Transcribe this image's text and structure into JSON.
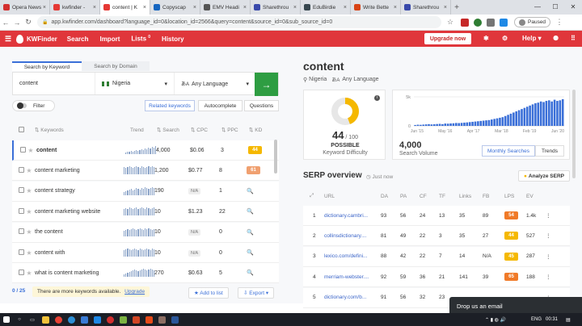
{
  "browser": {
    "tabs": [
      {
        "label": "Opera News",
        "color": "#d32f2f",
        "active": false
      },
      {
        "label": "kwfinder -",
        "color": "#e53935",
        "active": false
      },
      {
        "label": "content | K",
        "color": "#e53935",
        "active": true
      },
      {
        "label": "Copyscap",
        "color": "#1565c0",
        "active": false
      },
      {
        "label": "EMV Headi",
        "color": "#555555",
        "active": false
      },
      {
        "label": "Sharethrou",
        "color": "#3949ab",
        "active": false
      },
      {
        "label": "EduBirdie",
        "color": "#37474f",
        "active": false
      },
      {
        "label": "Write Bette",
        "color": "#d84315",
        "active": false
      },
      {
        "label": "Sharethrou",
        "color": "#3949ab",
        "active": false
      }
    ],
    "new_tab": "+",
    "url": "app.kwfinder.com/dashboard?language_id=0&location_id=2566&query=content&source_id=0&sub_source_id=0",
    "profile_label": "Paused"
  },
  "app": {
    "brand": "KWFinder",
    "nav": {
      "search": "Search",
      "import": "Import",
      "lists": "Lists",
      "lists_count": "0",
      "history": "History"
    },
    "upgrade_label": "Upgrade now",
    "help_label": "Help"
  },
  "search": {
    "tab_keyword": "Search by Keyword",
    "tab_domain": "Search by Domain",
    "query": "content",
    "location": "Nigeria",
    "language": "Any Language",
    "go": "→"
  },
  "filters": {
    "filter_label": "Filter",
    "tab_related": "Related keywords",
    "tab_autocomplete": "Autocomplete",
    "tab_questions": "Questions"
  },
  "table": {
    "headers": {
      "keywords": "Keywords",
      "trend": "Trend",
      "search": "Search",
      "cpc": "CPC",
      "ppc": "PPC",
      "kd": "KD"
    },
    "rows": [
      {
        "keyword": "content",
        "search": "4,000",
        "cpc": "$0.06",
        "ppc": "3",
        "kd": "44",
        "kd_color": "#f5b800",
        "trend": [
          2,
          3,
          3,
          4,
          3,
          4,
          5,
          4,
          5,
          6,
          5,
          7,
          6,
          8,
          7,
          9,
          8,
          10
        ]
      },
      {
        "keyword": "content marketing",
        "search": "1,200",
        "cpc": "$0.77",
        "ppc": "8",
        "kd": "61",
        "kd_color": "#f0a070",
        "trend": [
          9,
          8,
          9,
          10,
          9,
          8,
          9,
          10,
          9,
          8,
          10,
          9,
          8,
          9,
          10,
          9,
          10,
          9
        ]
      },
      {
        "keyword": "content strategy",
        "search": "190",
        "cpc": "N/A",
        "ppc": "1",
        "kd": "🔍",
        "kd_color": "",
        "trend": [
          4,
          5,
          6,
          7,
          8,
          6,
          7,
          9,
          8,
          7,
          9,
          8,
          10,
          9,
          8,
          9,
          10,
          9
        ]
      },
      {
        "keyword": "content marketing website",
        "search": "10",
        "cpc": "$1.23",
        "ppc": "22",
        "kd": "🔍",
        "kd_color": "",
        "trend": [
          8,
          9,
          8,
          10,
          9,
          8,
          9,
          10,
          8,
          9,
          10,
          9,
          8,
          10,
          9,
          8,
          9,
          10
        ]
      },
      {
        "keyword": "the content",
        "search": "10",
        "cpc": "N/A",
        "ppc": "0",
        "kd": "🔍",
        "kd_color": "",
        "trend": [
          7,
          8,
          9,
          8,
          9,
          10,
          9,
          8,
          9,
          10,
          9,
          8,
          10,
          9,
          10,
          9,
          8,
          9
        ]
      },
      {
        "keyword": "content with",
        "search": "10",
        "cpc": "N/A",
        "ppc": "0",
        "kd": "🔍",
        "kd_color": "",
        "trend": [
          8,
          9,
          10,
          9,
          8,
          9,
          10,
          9,
          8,
          10,
          9,
          8,
          9,
          10,
          9,
          8,
          10,
          9
        ]
      },
      {
        "keyword": "what is content marketing",
        "search": "270",
        "cpc": "$0.63",
        "ppc": "5",
        "kd": "🔍",
        "kd_color": "",
        "trend": [
          3,
          4,
          5,
          6,
          7,
          8,
          9,
          8,
          7,
          8,
          9,
          10,
          9,
          8,
          9,
          10,
          9,
          8
        ]
      }
    ],
    "count_selected": "0 / 25",
    "more_notice": "There are more keywords available.",
    "upgrade_link": "Upgrade",
    "add_to_list": "Add to list",
    "export": "Export"
  },
  "detail": {
    "keyword": "content",
    "location": "Nigeria",
    "language": "Any Language",
    "kd_value": "44",
    "kd_max": "/ 100",
    "kd_label": "POSSIBLE",
    "kd_caption": "Keyword Difficulty",
    "kd_fraction": 0.44,
    "volume": "4,000",
    "volume_caption": "Search Volume",
    "btn_monthly": "Monthly Searches",
    "btn_trends": "Trends"
  },
  "chart_data": {
    "type": "bar",
    "title": "",
    "y_ticks": [
      "5k",
      "0"
    ],
    "x_ticks": [
      "Jun '15",
      "May '16",
      "Apr '17",
      "Mar '18",
      "Feb '19",
      "Jun '20"
    ],
    "ylim": [
      0,
      5000
    ],
    "values": [
      150,
      200,
      180,
      220,
      260,
      300,
      250,
      280,
      320,
      350,
      300,
      400,
      380,
      420,
      450,
      500,
      480,
      520,
      560,
      600,
      650,
      700,
      750,
      800,
      850,
      900,
      950,
      1000,
      1100,
      1200,
      1300,
      1400,
      1500,
      1700,
      1900,
      2100,
      2300,
      2500,
      2700,
      2900,
      3100,
      3300,
      3500,
      3700,
      3900,
      4000,
      4200,
      4100,
      4300,
      4400,
      4200,
      4500,
      4300,
      4400,
      4600
    ]
  },
  "serp": {
    "title": "SERP overview",
    "timestamp": "Just now",
    "analyze_label": "Analyze SERP",
    "headers": {
      "url": "URL",
      "da": "DA",
      "pa": "PA",
      "cf": "CF",
      "tf": "TF",
      "links": "Links",
      "fb": "FB",
      "lps": "LPS",
      "ev": "EV"
    },
    "rows": [
      {
        "n": "1",
        "url": "dictionary.cambri...",
        "da": "93",
        "pa": "56",
        "cf": "24",
        "tf": "13",
        "links": "35",
        "fb": "89",
        "lps": "54",
        "lps_color": "#f07a28",
        "ev": "1.4k"
      },
      {
        "n": "2",
        "url": "collinsdictionary....",
        "da": "81",
        "pa": "49",
        "cf": "22",
        "tf": "3",
        "links": "35",
        "fb": "27",
        "lps": "44",
        "lps_color": "#f5b800",
        "ev": "527"
      },
      {
        "n": "3",
        "url": "lexico.com/defini...",
        "da": "88",
        "pa": "42",
        "cf": "22",
        "tf": "7",
        "links": "14",
        "fb": "N/A",
        "lps": "45",
        "lps_color": "#f5b800",
        "ev": "287"
      },
      {
        "n": "4",
        "url": "merriam-webster....",
        "da": "92",
        "pa": "59",
        "cf": "36",
        "tf": "21",
        "links": "141",
        "fb": "39",
        "lps": "65",
        "lps_color": "#f07a28",
        "ev": "188"
      },
      {
        "n": "5",
        "url": "dictionary.com/b...",
        "da": "91",
        "pa": "56",
        "cf": "32",
        "tf": "23",
        "links": "",
        "fb": "",
        "lps": "",
        "lps_color": "",
        "ev": ""
      }
    ]
  },
  "chat": {
    "label": "Drop us an email"
  },
  "taskbar": {
    "lang": "ENG",
    "time": "00:31"
  }
}
